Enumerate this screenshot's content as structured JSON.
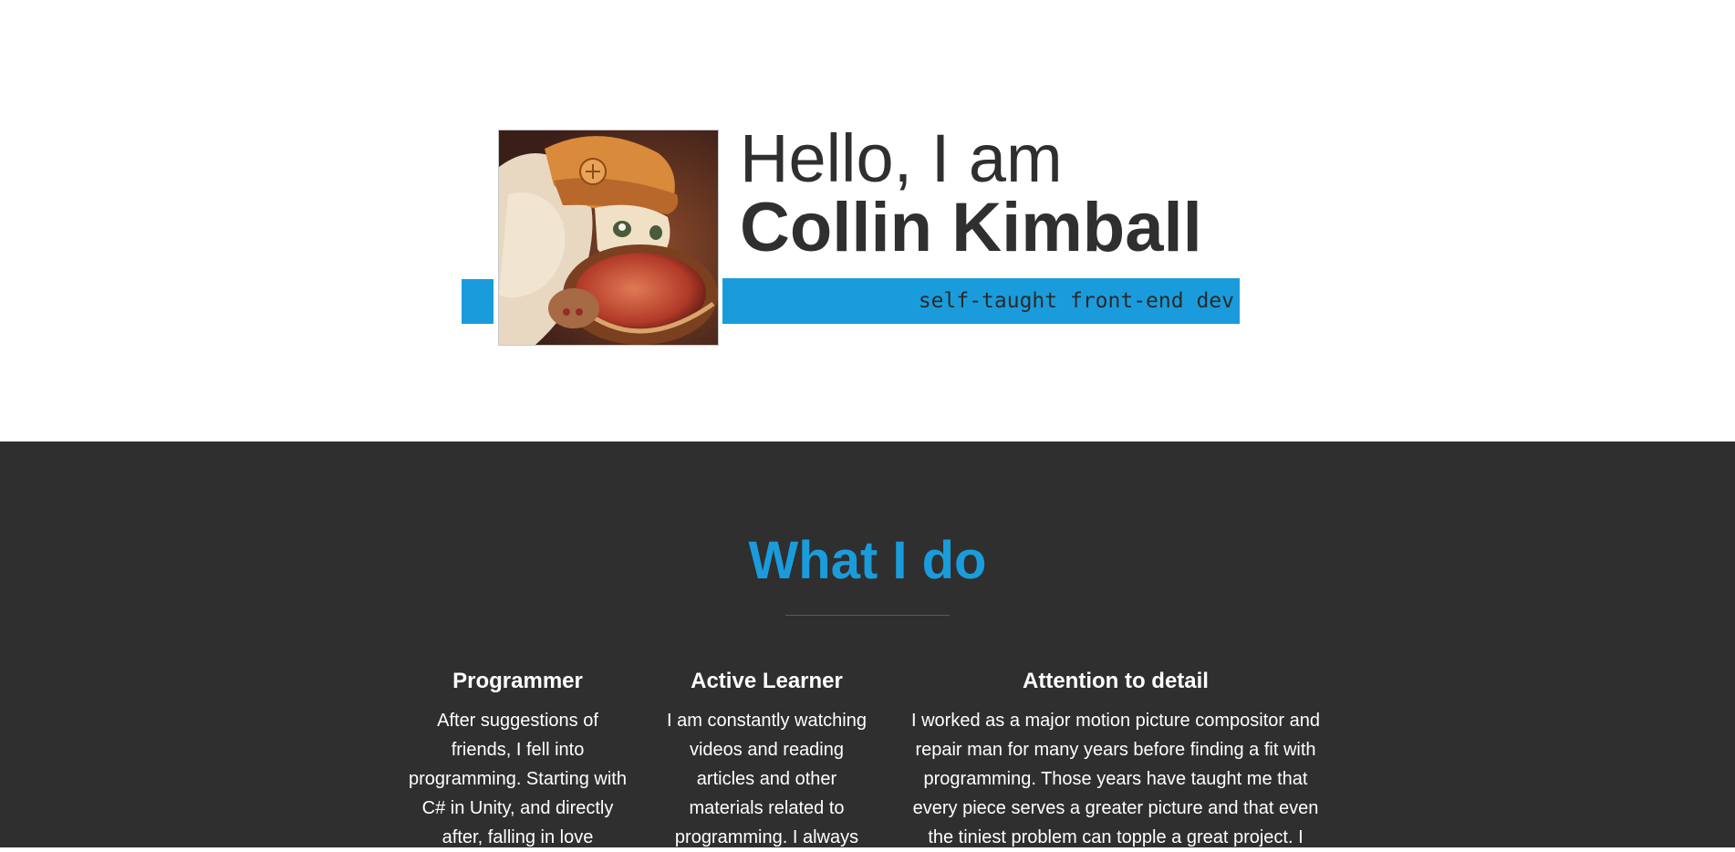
{
  "nav": {
    "menu_icon": "hamburger-icon"
  },
  "hero": {
    "greeting": "Hello, I am",
    "name": "Collin Kimball",
    "tagline": "self-taught front-end dev",
    "avatar_icon": "anime-character-avatar"
  },
  "what_i_do": {
    "title": "What I do",
    "columns": [
      {
        "heading": "Programmer",
        "text": "After suggestions of friends, I fell into programming. Starting with C# in Unity, and directly after, falling in love"
      },
      {
        "heading": "Active Learner",
        "text": "I am constantly watching videos and reading articles and other materials related to programming. I always"
      },
      {
        "heading": "Attention to detail",
        "text": "I worked as a major motion picture compositor and repair man for many years before finding a fit with programming. Those years have taught me that every piece serves a greater picture and that even the tiniest problem can topple a great project. I"
      }
    ]
  },
  "colors": {
    "accent": "#1a9cdc",
    "dark_bg": "#2f2f2f",
    "text_dark": "#2f2f2f",
    "text_light": "#ffffff"
  }
}
